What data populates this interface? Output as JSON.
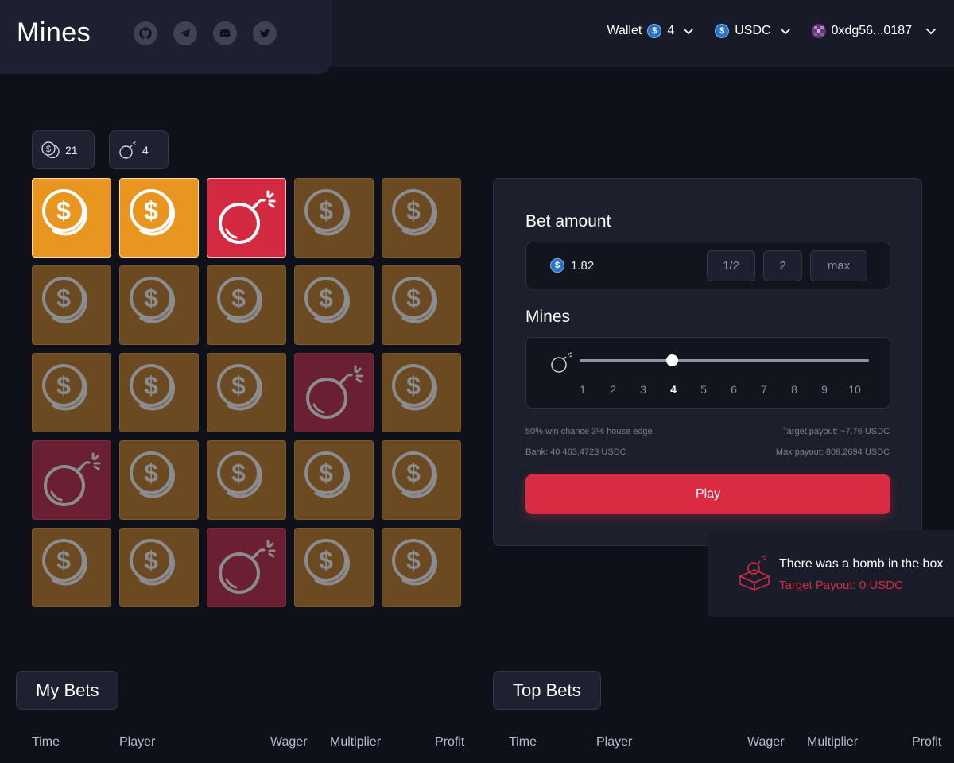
{
  "header": {
    "logo": "Mines",
    "socials": [
      "github-icon",
      "telegram-icon",
      "discord-icon",
      "twitter-icon"
    ],
    "wallet_label": "Wallet",
    "wallet_count": "4",
    "currency": "USDC",
    "address": "0xdg56...0187"
  },
  "counters": {
    "coins": "21",
    "bombs": "4"
  },
  "grid": {
    "tiles": [
      "coin-open",
      "coin-open",
      "bomb-open",
      "coin-dim",
      "coin-dim",
      "coin-dim",
      "coin-dim",
      "coin-dim",
      "coin-dim",
      "coin-dim",
      "coin-dim",
      "coin-dim",
      "coin-dim",
      "bomb-dim",
      "coin-dim",
      "bomb-dim",
      "coin-dim",
      "coin-dim",
      "coin-dim",
      "coin-dim",
      "coin-dim",
      "coin-dim",
      "bomb-dim",
      "coin-dim",
      "coin-dim"
    ]
  },
  "panel": {
    "bet_title": "Bet amount",
    "bet_value": "1.82",
    "half_label": "1/2",
    "double_label": "2",
    "max_label": "max",
    "mines_title": "Mines",
    "mines_options": [
      "1",
      "2",
      "3",
      "4",
      "5",
      "6",
      "7",
      "8",
      "9",
      "10"
    ],
    "mines_selected": 4,
    "win_info": "50% win chance 3% house edge",
    "bank_info": "Bank: 40 463,4723 USDC",
    "target_info": "Target payout: ~7.76 USDC",
    "max_info": "Max payout: 809,2694 USDC",
    "play_label": "Play"
  },
  "toast": {
    "title": "There was a bomb in the box",
    "subtitle": "Target Payout: 0 USDC"
  },
  "tables": {
    "my_bets_label": "My Bets",
    "top_bets_label": "Top Bets",
    "columns": [
      "Time",
      "Player",
      "Wager",
      "Multiplier",
      "Profit"
    ]
  },
  "colors": {
    "coin_open": "#e8961f",
    "bomb_open": "#d32a42",
    "coin_dim": "#6b4a22",
    "bomb_dim": "#6a1f33",
    "accent": "#d92b42",
    "usdc": "#2775ca"
  }
}
